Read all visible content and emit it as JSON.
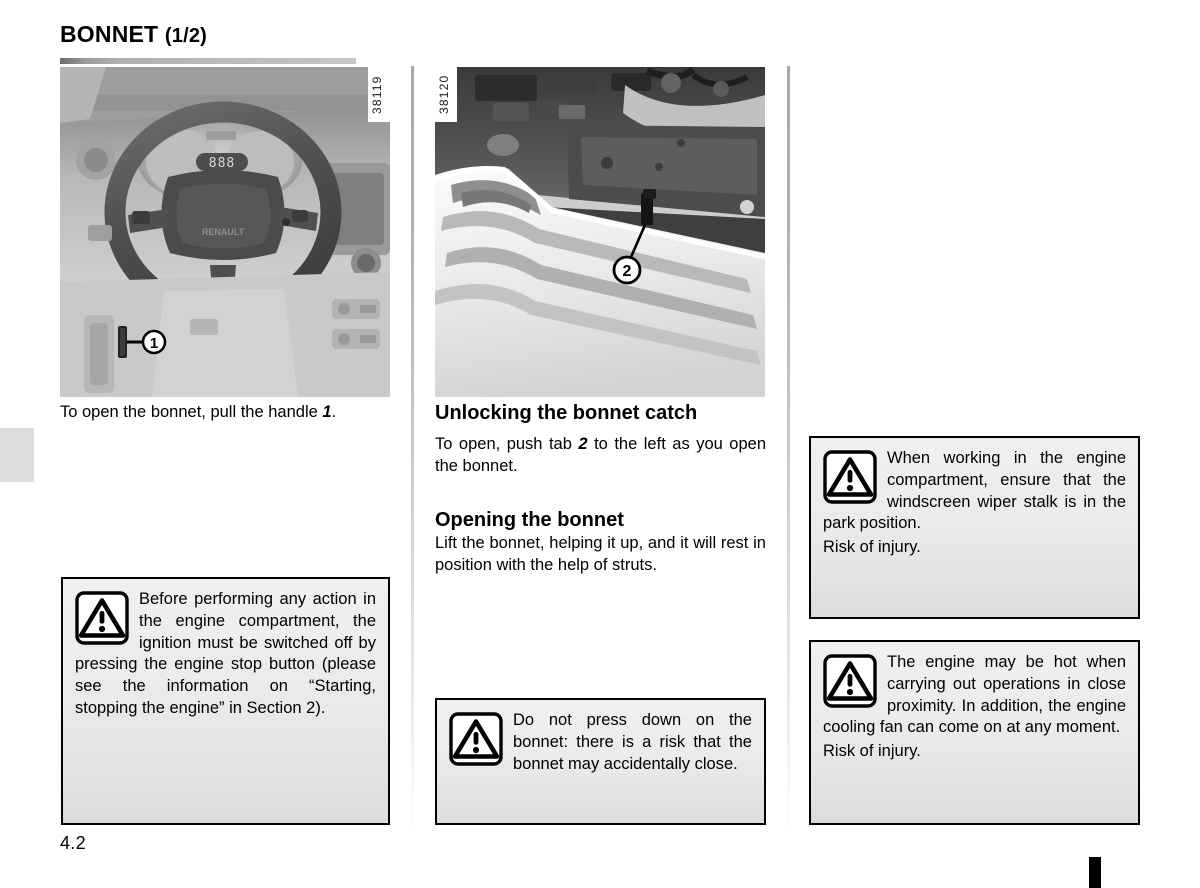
{
  "page": {
    "title_main": "BONNET",
    "title_suffix": "(1/2)",
    "page_number": "4.2"
  },
  "figures": [
    {
      "id": "38119",
      "alt": "car-interior-steering-wheel",
      "callout": "1"
    },
    {
      "id": "38120",
      "alt": "engine-bay-bonnet-catch",
      "callout": "2"
    }
  ],
  "left_column": {
    "caption_before": "To open the bonnet, pull the handle ",
    "caption_bold": "1",
    "caption_after": ".",
    "warning": {
      "text_main": "Before performing any action in the engine compartment, the ignition must be switched off by pressing the engine stop button (please see the information on “Starting, stopping the engine” in Section 2).",
      "icon": "warning-triangle-icon"
    }
  },
  "middle_column": {
    "heading_unlock": "Unlocking the bonnet catch",
    "para_unlock_before": "To open, push tab ",
    "para_unlock_bold": "2",
    "para_unlock_after": " to the left as you open the bonnet.",
    "heading_open": "Opening the bonnet",
    "para_open": "Lift the bonnet, helping it up, and it will rest in position with the help of struts.",
    "warning": {
      "text_main": "Do not press down on the bonnet: there is a risk that the bonnet may accidentally close.",
      "icon": "warning-triangle-icon"
    }
  },
  "right_column": {
    "warning_1": {
      "text_main": "When working in the engine compartment, ensure that the windscreen wiper stalk is in the park position.",
      "text_after": "Risk of injury.",
      "icon": "warning-triangle-icon"
    },
    "warning_2": {
      "text_main": "The engine may be hot when carrying out operations in close proximity. In addition, the engine cooling fan can come on at any moment.",
      "text_after": "Risk of injury.",
      "icon": "warning-triangle-icon"
    }
  },
  "colors": {
    "text": "#000000",
    "warning_box_bg": "#ebebeb",
    "warning_box_border": "#000000",
    "rule": "#9b9b9b",
    "edge_tab": "#dcdcdc",
    "corner_marker": "#000000"
  }
}
